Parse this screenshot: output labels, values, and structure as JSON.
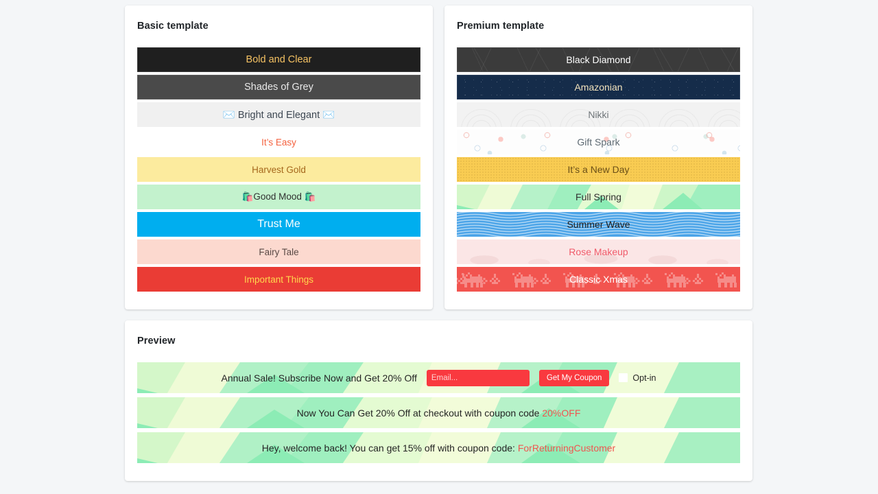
{
  "basic": {
    "title": "Basic template",
    "bars": [
      {
        "label": "Bold and Clear",
        "style": "b-bold"
      },
      {
        "label": "Shades of Grey",
        "style": "b-grey"
      },
      {
        "label": "✉️ Bright and Elegant ✉️",
        "style": "b-bright"
      },
      {
        "label": "It’s Easy",
        "style": "b-easy"
      },
      {
        "label": "Harvest Gold",
        "style": "b-harvest"
      },
      {
        "label": "🛍️Good Mood 🛍️",
        "style": "b-goodmood"
      },
      {
        "label": "Trust Me",
        "style": "b-trust"
      },
      {
        "label": "Fairy Tale",
        "style": "b-fairy"
      },
      {
        "label": "Important Things",
        "style": "b-important"
      }
    ]
  },
  "premium": {
    "title": "Premium template",
    "bars": [
      {
        "label": "Black Diamond",
        "style": "p-blackdiamond",
        "pattern": "faceted-polygon"
      },
      {
        "label": "Amazonian",
        "style": "p-amazonian",
        "pattern": "starry-night"
      },
      {
        "label": "Nikki",
        "style": "p-nikki",
        "pattern": "seigaiha-scallop"
      },
      {
        "label": "Gift Spark",
        "style": "p-giftspark",
        "pattern": "confetti"
      },
      {
        "label": "It’s a New Day",
        "style": "p-newday",
        "pattern": "halftone-dots"
      },
      {
        "label": "Full Spring",
        "style": "p-fullspring",
        "pattern": "low-poly-green"
      },
      {
        "label": "Summer Wave",
        "style": "p-summerwave",
        "pattern": "wavy-lines"
      },
      {
        "label": "Rose Makeup",
        "style": "p-rosemakeup",
        "pattern": "soft-blush"
      },
      {
        "label": "Classic Xmas",
        "style": "p-xmas",
        "pattern": "nordic-reindeer"
      }
    ]
  },
  "preview": {
    "title": "Preview",
    "bars": [
      {
        "kind": "signup",
        "text": "Annual Sale! Subscribe Now and Get 20% Off",
        "email_placeholder": "Email...",
        "email_value": "",
        "button_label": "Get My Coupon",
        "optin_label": "Opt-in",
        "optin_checked": false
      },
      {
        "kind": "message",
        "text_before": "Now You Can Get 20% Off at checkout with coupon code ",
        "code": "20%OFF",
        "text_after": ""
      },
      {
        "kind": "message",
        "text_before": "Hey, welcome back! You can get 15% off with coupon code: ",
        "code": "ForReturningCustomer",
        "text_after": ""
      }
    ]
  },
  "colors": {
    "page_background": "#f4f6f8",
    "card_background": "#ffffff",
    "accent_red": "#f9393f",
    "coupon_code": "#f0554f",
    "bold_and_clear_bg": "#1f1f1f",
    "bold_and_clear_text": "#f5c263",
    "shades_of_grey_bg": "#4a4a4a",
    "trust_me_bg": "#00aeef",
    "important_things_bg": "#ea3c35",
    "important_things_text": "#ffd84d",
    "its_easy_text": "#f4613e",
    "harvest_gold_bg": "#fceb9e",
    "good_mood_bg": "#c3f2cd",
    "fairy_tale_bg": "#fcd9cf",
    "black_diamond_bg": "#3b3b3b",
    "amazonian_bg": "#152c4a",
    "nikki_bg": "#f2f2f2",
    "new_day_bg": "#f9cc52",
    "full_spring_bg": "#e9fbcf",
    "summer_wave_bg": "#4ba4e8",
    "rose_makeup_bg": "#fbe6e6",
    "rose_makeup_text": "#f05b6a",
    "classic_xmas_bg": "#f2544f"
  }
}
